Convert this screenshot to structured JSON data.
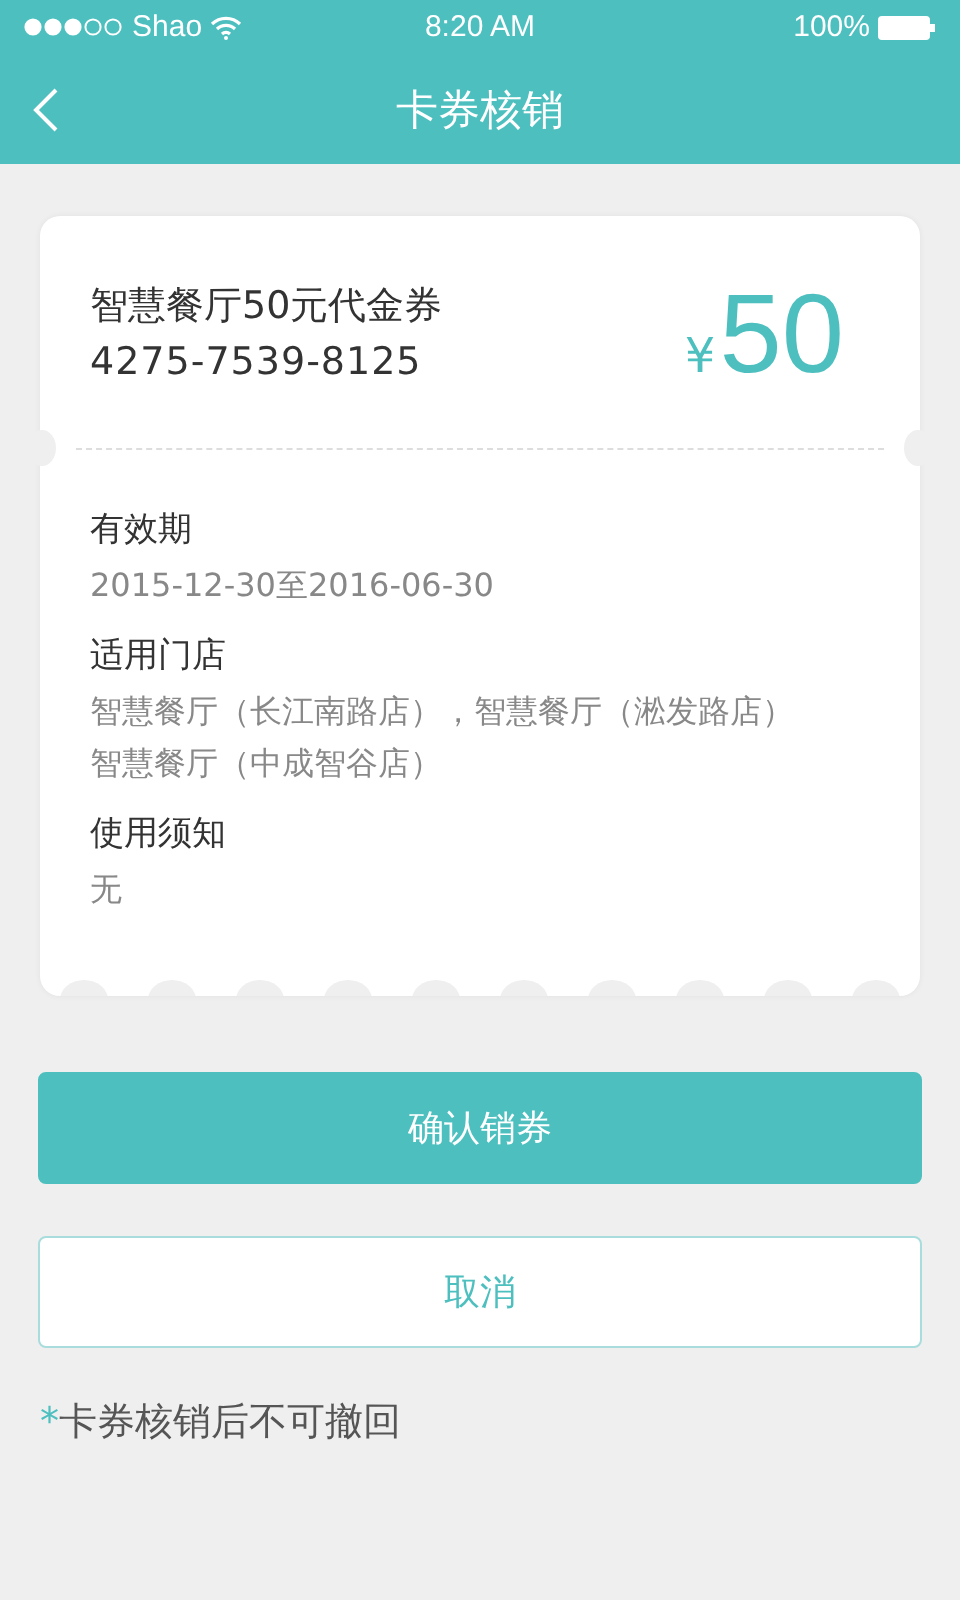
{
  "status_bar": {
    "carrier": "Shao",
    "time": "8:20 AM",
    "battery": "100%"
  },
  "nav": {
    "title": "卡券核销"
  },
  "coupon": {
    "name": "智慧餐厅50元代金券",
    "code": "4275-7539-8125",
    "currency": "¥",
    "amount": "50",
    "sections": [
      {
        "label": "有效期",
        "lines": [
          "2015-12-30至2016-06-30"
        ]
      },
      {
        "label": "适用门店",
        "lines": [
          "智慧餐厅（长江南路店），智慧餐厅（淞发路店）",
          "智慧餐厅（中成智谷店）"
        ]
      },
      {
        "label": "使用须知",
        "lines": [
          "无"
        ]
      }
    ]
  },
  "buttons": [
    {
      "label": "确认销券",
      "kind": "primary"
    },
    {
      "label": "取消",
      "kind": "secondary"
    }
  ],
  "note": {
    "mark": "*",
    "text": "卡券核销后不可撤回"
  }
}
